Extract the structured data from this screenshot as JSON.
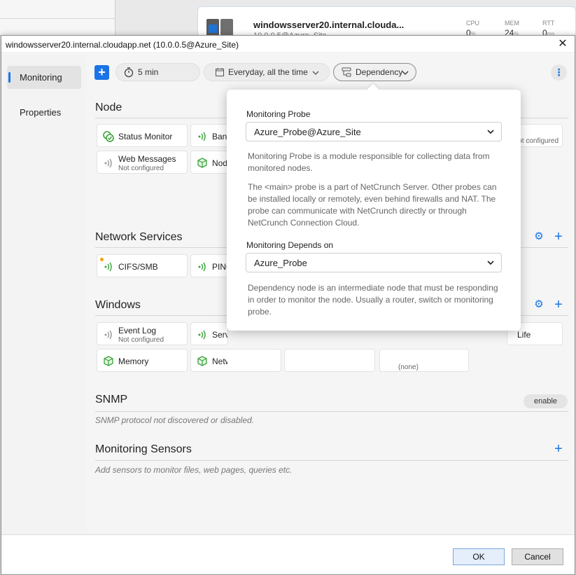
{
  "background": {
    "server_name": "windowsserver20.internal.clouda...",
    "server_sub": "10.0.0.5@Azure_Site",
    "stats": [
      {
        "label": "CPU",
        "value": "0",
        "unit": "%"
      },
      {
        "label": "MEM",
        "value": "24",
        "unit": "%"
      },
      {
        "label": "RTT",
        "value": "0",
        "unit": "ms"
      }
    ]
  },
  "dialog": {
    "title": "windowsserver20.internal.cloudapp.net (10.0.0.5@Azure_Site)",
    "close_glyph": "✕"
  },
  "sidebar": {
    "items": [
      {
        "label": "Monitoring",
        "active": true
      },
      {
        "label": "Properties",
        "active": false
      }
    ]
  },
  "toolbar": {
    "add_glyph": "+",
    "interval": "5 min",
    "schedule": "Everyday, all the time",
    "dependency": "Dependency",
    "more_glyph": "⋮"
  },
  "sections": {
    "node": {
      "title": "Node",
      "cards": [
        {
          "name": "Status Monitor",
          "icon": "status-monitor-icon"
        },
        {
          "name": "Bandwidth",
          "icon": "bandwidth-icon"
        },
        {
          "name": "Web Messages",
          "sub": "Not configured",
          "icon": "web-messages-icon"
        },
        {
          "name": "Node",
          "icon": "node-cube-icon"
        },
        {
          "name": "",
          "sub": "Not configured"
        }
      ]
    },
    "network": {
      "title": "Network Services",
      "cards": [
        {
          "name": "CIFS/SMB",
          "icon": "cifs-icon"
        },
        {
          "name": "PING",
          "icon": "ping-icon"
        }
      ]
    },
    "windows": {
      "title": "Windows",
      "cards": [
        {
          "name": "Event Log",
          "sub": "Not configured",
          "icon": "event-log-icon"
        },
        {
          "name": "Services",
          "icon": "services-icon"
        },
        {
          "name": "Memory",
          "icon": "memory-cube-icon"
        },
        {
          "name": "Network",
          "icon": "network-cube-icon"
        },
        {
          "name": "Life"
        },
        {
          "name": "",
          "sub": "(none)"
        }
      ]
    },
    "snmp": {
      "title": "SNMP",
      "note": "SNMP protocol not discovered or disabled.",
      "enable_label": "enable"
    },
    "sensors": {
      "title": "Monitoring Sensors",
      "note": "Add sensors to monitor files, web pages, queries etc."
    }
  },
  "popover": {
    "probe_label": "Monitoring Probe",
    "probe_value": "Azure_Probe@Azure_Site",
    "probe_desc1": "Monitoring Probe is a module responsible for collecting data from monitored nodes.",
    "probe_desc2": "The <main> probe is a part of NetCrunch Server. Other probes can be installed locally or remotely, even behind firewalls and NAT. The probe can communicate with NetCrunch directly or through NetCrunch Connection Cloud.",
    "depends_label": "Monitoring Depends on",
    "depends_value": "Azure_Probe",
    "depends_desc": "Dependency node is an intermediate node that must be responding in order to monitor the node. Usually a router, switch or monitoring probe."
  },
  "footer": {
    "ok_label": "OK",
    "cancel_label": "Cancel"
  },
  "colors": {
    "accent": "#1a74e8",
    "green_icon": "#3aa33a",
    "warning_dot": "#f5a200"
  }
}
